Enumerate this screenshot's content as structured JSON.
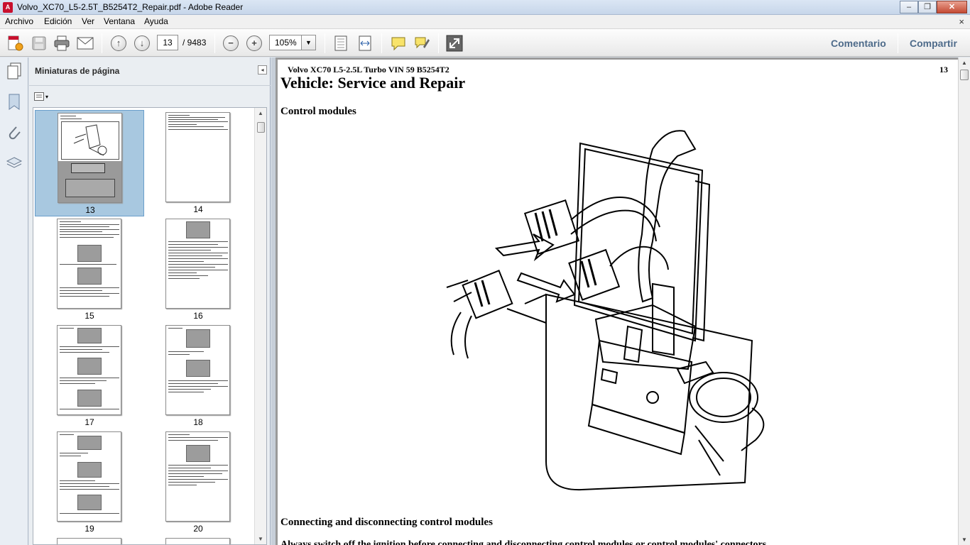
{
  "window": {
    "title": "Volvo_XC70_L5-2.5T_B5254T2_Repair.pdf - Adobe Reader",
    "minimize_glyph": "–",
    "maximize_glyph": "❐",
    "close_glyph": "✕"
  },
  "menu": {
    "items": [
      "Archivo",
      "Edición",
      "Ver",
      "Ventana",
      "Ayuda"
    ],
    "close_glyph": "×"
  },
  "toolbar": {
    "current_page": "13",
    "total_pages": "/ 9483",
    "zoom": "105%",
    "zoom_dropdown_glyph": "▼",
    "prev_glyph": "↑",
    "next_glyph": "↓",
    "zoom_out_glyph": "−",
    "zoom_in_glyph": "+",
    "comment_label": "Comentario",
    "share_label": "Compartir",
    "icons": [
      "create-pdf-icon",
      "save-icon",
      "print-icon",
      "email-icon",
      "previous-page-icon",
      "next-page-icon",
      "zoom-out-icon",
      "zoom-in-icon",
      "fit-page-icon",
      "fit-width-icon",
      "comment-icon",
      "highlight-icon",
      "fullscreen-icon"
    ]
  },
  "navstrip": {
    "icons": [
      "page-thumbnails-icon",
      "bookmarks-icon",
      "attachments-icon",
      "layers-icon"
    ]
  },
  "thumbnails_panel": {
    "title": "Miniaturas de página",
    "collapse_glyph": "◂",
    "options_glyph": "▾",
    "scroll_up_glyph": "▲",
    "scroll_down_glyph": "▼",
    "pages": [
      {
        "number": "13",
        "selected": true
      },
      {
        "number": "14",
        "selected": false
      },
      {
        "number": "15",
        "selected": false
      },
      {
        "number": "16",
        "selected": false
      },
      {
        "number": "17",
        "selected": false
      },
      {
        "number": "18",
        "selected": false
      },
      {
        "number": "19",
        "selected": false
      },
      {
        "number": "20",
        "selected": false
      }
    ]
  },
  "document": {
    "header": "Volvo XC70 L5-2.5L Turbo VIN 59 B5254T2",
    "page_number": "13",
    "title": "Vehicle: Service and Repair",
    "section": "Control modules",
    "section2": "Connecting and disconnecting control modules",
    "clipped_line": "Always switch off the ignition before connecting and disconnecting control modules or control modules' connectors.",
    "scroll_up_glyph": "▲",
    "scroll_down_glyph": "▼"
  }
}
